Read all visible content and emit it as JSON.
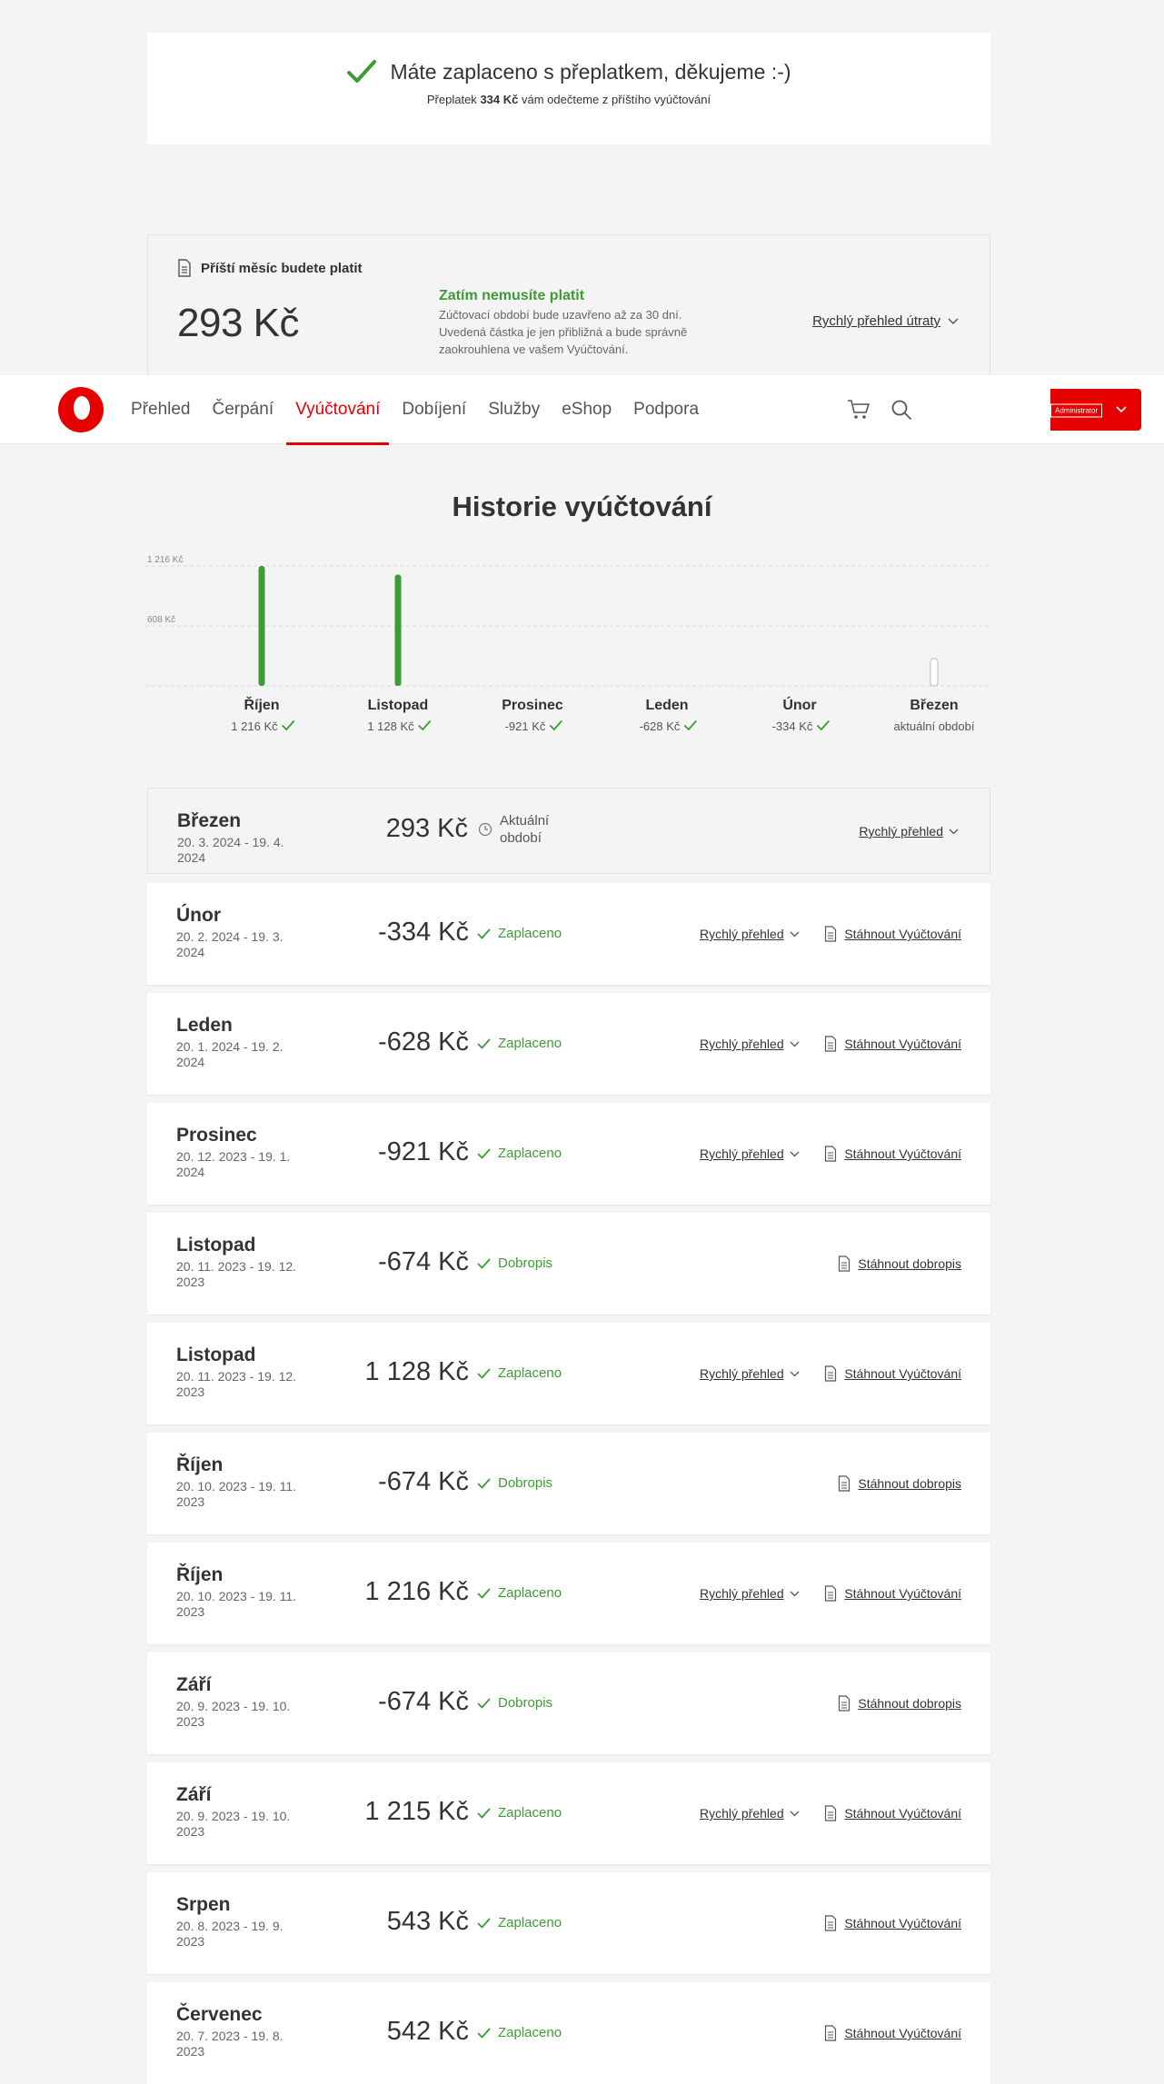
{
  "banner": {
    "title": "Máte zaplaceno s přeplatkem, děkujeme :-)",
    "sub_prefix": "Přeplatek",
    "sub_amount": "334 Kč",
    "sub_suffix": "vám odečteme z příštího vyúčtování"
  },
  "next_month": {
    "label": "Příští měsíc budete platit",
    "amount": "293 Kč",
    "info_title": "Zatím nemusíte platit",
    "info_text": "Zúčtovací období bude uzavřeno až za 30 dní. Uvedená částka je jen přibližná a bude správně zaokrouhlena ve vašem Vyúčtování.",
    "quick_label": "Rychlý přehled útraty"
  },
  "nav": {
    "items": [
      "Přehled",
      "Čerpání",
      "Vyúčtování",
      "Dobíjení",
      "Služby",
      "eShop",
      "Podpora"
    ],
    "active_index": 2,
    "account_role": "Administrator"
  },
  "history": {
    "title": "Historie vyúčtování"
  },
  "chart_data": {
    "type": "bar",
    "categories": [
      "Říjen",
      "Listopad",
      "Prosinec",
      "Leden",
      "Únor",
      "Březen"
    ],
    "values": [
      1216,
      1128,
      -921,
      -628,
      -334,
      0
    ],
    "value_labels": [
      "1 216 Kč",
      "1 128 Kč",
      "-921 Kč",
      "-628 Kč",
      "-334 Kč",
      "aktuální období"
    ],
    "paid": [
      true,
      true,
      true,
      true,
      true,
      false
    ],
    "current_index": 5,
    "ytick_labels": [
      "1 216 Kč",
      "608 Kč"
    ],
    "yticks": [
      1216,
      608
    ],
    "ylim": [
      0,
      1216
    ],
    "grid": true,
    "bar_color": "#3d9b35"
  },
  "list": {
    "current": {
      "month": "Březen",
      "period": "20. 3. 2024 - 19. 4. 2024",
      "amount": "293 Kč",
      "status": "Aktuální období",
      "quick": "Rychlý přehled"
    },
    "rows": [
      {
        "month": "Únor",
        "period": "20. 2. 2024 - 19. 3. 2024",
        "amount": "-334 Kč",
        "status": "Zaplaceno",
        "quick": "Rychlý přehled",
        "download": "Stáhnout Vyúčtování"
      },
      {
        "month": "Leden",
        "period": "20. 1. 2024 - 19. 2. 2024",
        "amount": "-628 Kč",
        "status": "Zaplaceno",
        "quick": "Rychlý přehled",
        "download": "Stáhnout Vyúčtování"
      },
      {
        "month": "Prosinec",
        "period": "20. 12. 2023 - 19. 1. 2024",
        "amount": "-921 Kč",
        "status": "Zaplaceno",
        "quick": "Rychlý přehled",
        "download": "Stáhnout Vyúčtování"
      },
      {
        "month": "Listopad",
        "period": "20. 11. 2023 - 19. 12. 2023",
        "amount": "-674 Kč",
        "status": "Dobropis",
        "quick": "",
        "download": "Stáhnout dobropis"
      },
      {
        "month": "Listopad",
        "period": "20. 11. 2023 - 19. 12. 2023",
        "amount": "1 128 Kč",
        "status": "Zaplaceno",
        "quick": "Rychlý přehled",
        "download": "Stáhnout Vyúčtování"
      },
      {
        "month": "Říjen",
        "period": "20. 10. 2023 - 19. 11. 2023",
        "amount": "-674 Kč",
        "status": "Dobropis",
        "quick": "",
        "download": "Stáhnout dobropis"
      },
      {
        "month": "Říjen",
        "period": "20. 10. 2023 - 19. 11. 2023",
        "amount": "1 216 Kč",
        "status": "Zaplaceno",
        "quick": "Rychlý přehled",
        "download": "Stáhnout Vyúčtování"
      },
      {
        "month": "Září",
        "period": "20. 9. 2023 - 19. 10. 2023",
        "amount": "-674 Kč",
        "status": "Dobropis",
        "quick": "",
        "download": "Stáhnout dobropis"
      },
      {
        "month": "Září",
        "period": "20. 9. 2023 - 19. 10. 2023",
        "amount": "1 215 Kč",
        "status": "Zaplaceno",
        "quick": "Rychlý přehled",
        "download": "Stáhnout Vyúčtování"
      },
      {
        "month": "Srpen",
        "period": "20. 8. 2023 - 19. 9. 2023",
        "amount": "543 Kč",
        "status": "Zaplaceno",
        "quick": "",
        "download": "Stáhnout Vyúčtování"
      },
      {
        "month": "Červenec",
        "period": "20. 7. 2023 - 19. 8. 2023",
        "amount": "542 Kč",
        "status": "Zaplaceno",
        "quick": "",
        "download": "Stáhnout Vyúčtování"
      }
    ]
  },
  "colors": {
    "brand_red": "#e60000",
    "success_green": "#3d9b35"
  }
}
